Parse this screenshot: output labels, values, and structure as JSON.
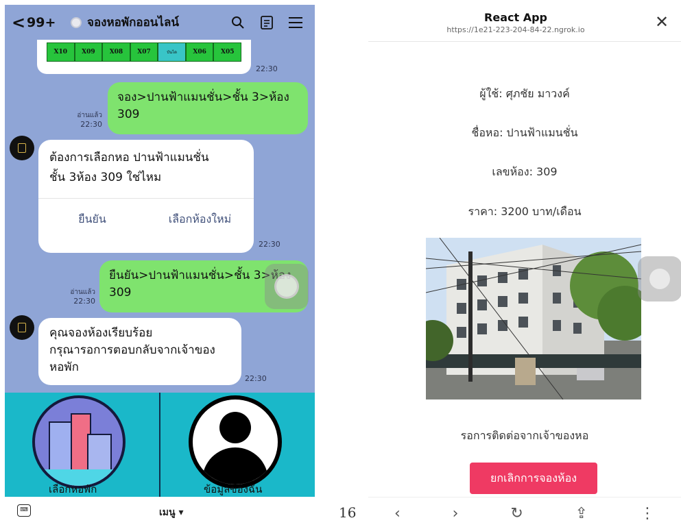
{
  "chat": {
    "header": {
      "back_glyph": "<",
      "unread_count": "99+",
      "title": "จองหอพักออนไลน์",
      "search_glyph": "⚲",
      "notes_glyph": "☰",
      "menu_glyph": "≡"
    },
    "seat_map": [
      "X10",
      "X09",
      "X08",
      "X07",
      "บันได",
      "X06",
      "X05"
    ],
    "messages": {
      "image_time": "22:30",
      "user_1": {
        "text_line1": "จอง>ปานฟ้าแมนชั่น>ชั้น 3>ห้อง",
        "text_line2": "309",
        "read": "อ่านแล้ว",
        "time": "22:30"
      },
      "bot_confirm": {
        "line1": "ต้องการเลือกหอ ปานฟ้าแมนชั่น",
        "line2": "ชั้น 3ห้อง 309 ใช่ไหม",
        "confirm_label": "ยืนยัน",
        "change_label": "เลือกห้องใหม่",
        "time": "22:30"
      },
      "user_2": {
        "text_line1": "ยืนยัน>ปานฟ้าแมนชั่น>ชั้น 3>ห้อง",
        "text_line2": "309",
        "read": "อ่านแล้ว",
        "time": "22:30"
      },
      "bot_done": {
        "line1": "คุณจองห้องเรียบร้อย",
        "line2": "กรุณารอการตอบกลับจากเจ้าของ",
        "line3": "หอพัก",
        "time": "22:30"
      }
    },
    "rich_menu": {
      "left_label": "เลือกหอพัก",
      "right_label": "ข้อมูลของฉัน"
    },
    "footer": {
      "keyboard_glyph": "⌨",
      "menu_label": "เมนู ▾"
    }
  },
  "page_number": "16",
  "browser": {
    "title": "React App",
    "url": "https://1e21-223-204-84-22.ngrok.io",
    "close_glyph": "✕",
    "user_line": "ผู้ใช้: ศุภชัย มาวงค์",
    "dorm_line": "ชื่อหอ: ปานฟ้าแมนชั่น",
    "room_line": "เลขห้อง: 309",
    "price_line": "ราคา: 3200 บาท/เดือน",
    "status": "รอการติดต่อจากเจ้าของหอ",
    "cancel_label": "ยกเลิกการจองห้อง",
    "nav": {
      "back": "‹",
      "forward": "›",
      "reload": "↻",
      "share": "⇪",
      "more": "⋮"
    }
  }
}
